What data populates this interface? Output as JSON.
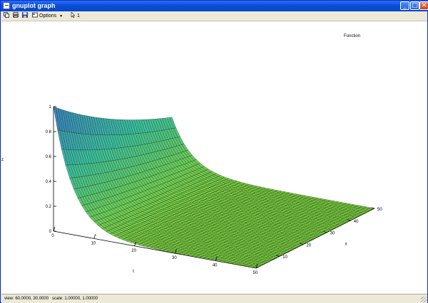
{
  "window": {
    "title": "gnuplot graph"
  },
  "title_buttons": {
    "minimize": "_",
    "maximize": "□",
    "close": "✕"
  },
  "toolbar": {
    "items": [
      {
        "icon": "copy-icon"
      },
      {
        "icon": "print-icon"
      },
      {
        "icon": "save-icon"
      },
      {
        "icon": "options-icon",
        "label": "Options",
        "has_dropdown": true
      },
      {
        "icon": "mouse-icon",
        "label": "1"
      }
    ]
  },
  "chart_data": {
    "type": "surface3d",
    "key_label": "Function",
    "xlabel": "t",
    "ylabel": "x",
    "zlabel": "z",
    "xlim": [
      0,
      50
    ],
    "ylim": [
      0,
      50
    ],
    "zlim": [
      0,
      1
    ],
    "x_ticks": [
      "0",
      "10",
      "20",
      "30",
      "40",
      "50"
    ],
    "y_ticks": [
      "10",
      "20",
      "30",
      "40",
      "50"
    ],
    "z_ticks": [
      "0",
      "0.2",
      "0.4",
      "0.6",
      "0.8",
      "1"
    ],
    "grid_samples": 50,
    "view": "60.0000, 30.0000",
    "scale": "1.00000, 1.00000",
    "shape": "z = exp(-t/5) at x = 0, with small decaying ripples along x",
    "colors": {
      "surface_low": "#7fcf3f",
      "surface_mid": "#3bbf9f",
      "surface_high": "#3a78c8",
      "mesh": "#1a3a1a"
    }
  },
  "status": {
    "text": "view: 60.0000, 30.0000   scale: 1.00000, 1.00000"
  }
}
